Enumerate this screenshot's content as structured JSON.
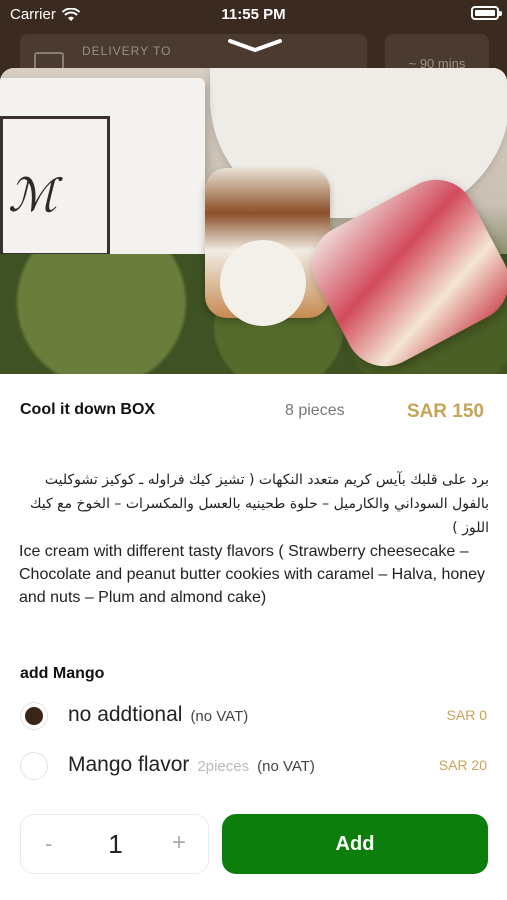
{
  "status_bar": {
    "carrier": "Carrier",
    "time": "11:55 PM"
  },
  "background": {
    "delivery_label": "DELIVERY TO",
    "eta": "~ 90 mins"
  },
  "product": {
    "title": "Cool it down BOX",
    "pieces": "8 pieces",
    "price": "SAR 150",
    "description_ar": "برد على قلبك بآيس كريم متعدد النكهات ( تشيز كيك فراوله ـ كوكيز تشوكليت بالفول السوداني والكارميل – حلوة طحينيه بالعسل والمكسرات – الخوخ مع كيك اللوز )",
    "description_en": "Ice cream with different tasty flavors ( Strawberry cheesecake – Chocolate and peanut butter cookies with caramel – Halva, honey and nuts – Plum and almond cake)"
  },
  "addon_section": {
    "title": "add Mango",
    "options": [
      {
        "name": "no addtional",
        "extra": "",
        "vat": "(no VAT)",
        "price": "SAR 0",
        "selected": true
      },
      {
        "name": "Mango flavor",
        "extra": "2pieces",
        "vat": "(no VAT)",
        "price": "SAR 20",
        "selected": false
      }
    ]
  },
  "quantity": {
    "minus": "-",
    "value": "1",
    "plus": "+"
  },
  "add_button": {
    "label": "Add"
  },
  "colors": {
    "price_gold": "#c6a356",
    "add_green": "#0d7e0b",
    "radio_selected": "#3a2418"
  }
}
